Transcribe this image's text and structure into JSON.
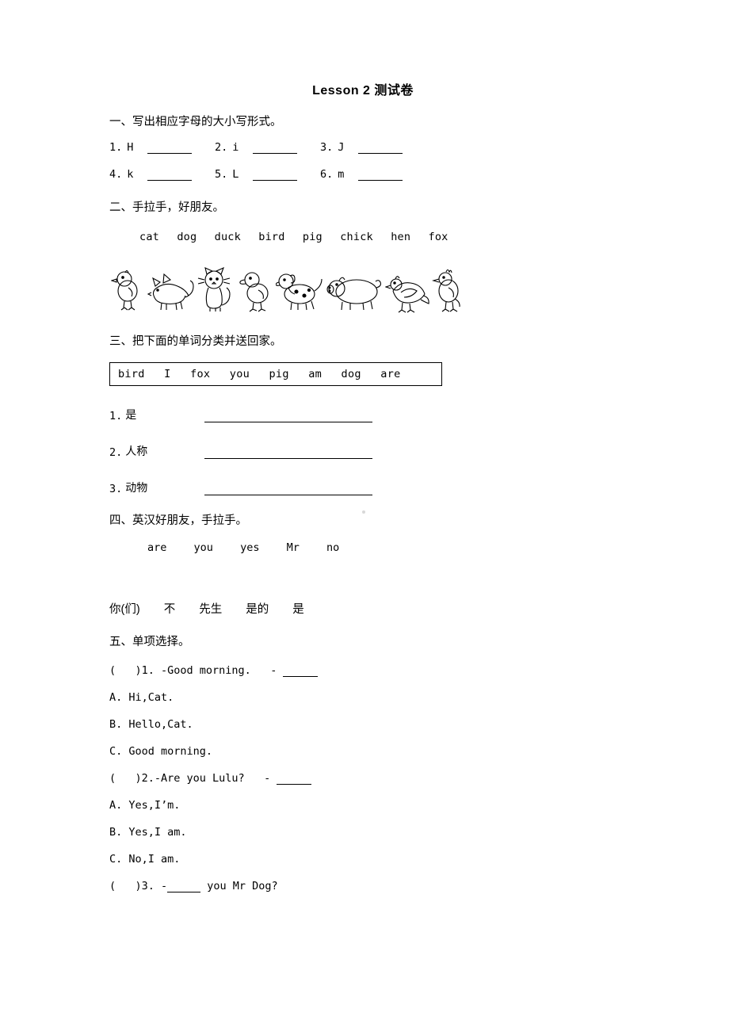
{
  "document": {
    "title": "Lesson 2 测试卷"
  },
  "sections": [
    {
      "heading": "一、写出相应字母的大小写形式。",
      "items": [
        {
          "num": "1.",
          "letter": "H"
        },
        {
          "num": "2.",
          "letter": "i"
        },
        {
          "num": "3.",
          "letter": "J"
        },
        {
          "num": "4.",
          "letter": "k"
        },
        {
          "num": "5.",
          "letter": "L"
        },
        {
          "num": "6.",
          "letter": "m"
        }
      ]
    },
    {
      "heading": "二、手拉手，好朋友。",
      "words": [
        "cat",
        "dog",
        "duck",
        "bird",
        "pig",
        "chick",
        "hen",
        "fox"
      ],
      "pictures": [
        "chick",
        "fox",
        "cat",
        "duck",
        "dog",
        "pig",
        "hen",
        "bird"
      ]
    },
    {
      "heading": "三、把下面的单词分类并送回家。",
      "wordbank": [
        "bird",
        "I",
        "fox",
        "you",
        "pig",
        "am",
        "dog",
        "are"
      ],
      "categories": [
        {
          "num": "1.",
          "label": "是"
        },
        {
          "num": "2.",
          "label": "人称"
        },
        {
          "num": "3.",
          "label": "动物"
        }
      ]
    },
    {
      "heading": "四、英汉好朋友，手拉手。",
      "english": [
        "are",
        "you",
        "yes",
        "Mr",
        "no"
      ],
      "chinese": [
        "你(们)",
        "不",
        "先生",
        "是的",
        "是"
      ]
    },
    {
      "heading": "五、单项选择。",
      "questions": [
        {
          "stem": "(   )1. -Good morning.   - ",
          "options": [
            "A. Hi,Cat.",
            "B. Hello,Cat.",
            "C. Good morning."
          ]
        },
        {
          "stem": "(   )2.-Are you Lulu?   - ",
          "options": [
            "A. Yes,I’m.",
            "B. Yes,I am.",
            "C. No,I am."
          ]
        },
        {
          "stem_pre": "(   )3. -",
          "stem_post": " you Mr Dog?",
          "options": []
        }
      ]
    }
  ]
}
